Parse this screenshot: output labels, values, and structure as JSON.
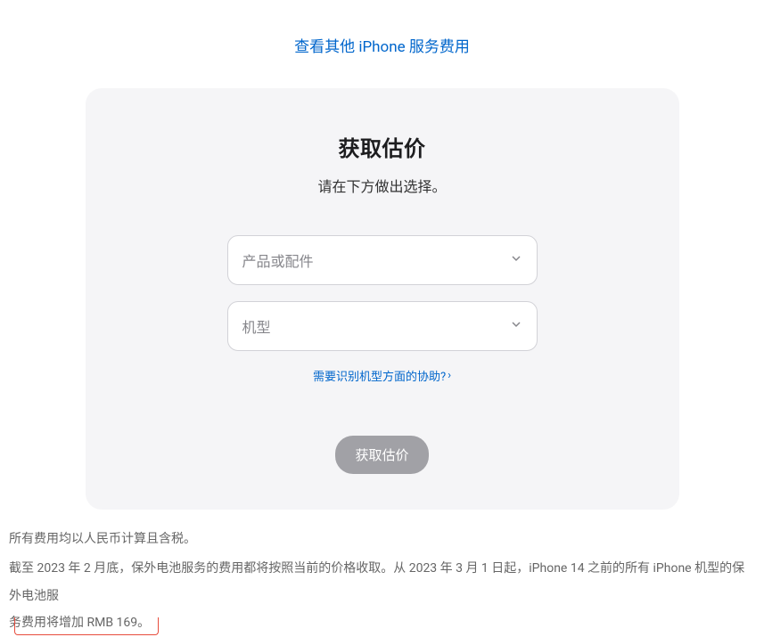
{
  "topLink": {
    "label": "查看其他 iPhone 服务费用"
  },
  "card": {
    "title": "获取估价",
    "subtitle": "请在下方做出选择。",
    "select1Placeholder": "产品或配件",
    "select2Placeholder": "机型",
    "helpLink": "需要识别机型方面的协助?",
    "helpChevron": "›",
    "submitLabel": "获取估价"
  },
  "footer": {
    "line1": "所有费用均以人民币计算且含税。",
    "line2_part1": "截至 2023 年 2 月底，保外电池服务的费用都将按照当前的价格收取。从 2023 年 3 月 1 日起，iPhone 14 之前的所有 iPhone 机型的保外电池服",
    "line2_part2": "务费用将增加 RMB 169。"
  }
}
